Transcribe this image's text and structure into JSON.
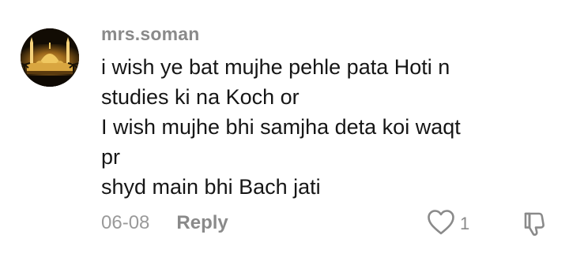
{
  "comment": {
    "username": "mrs.soman",
    "avatar_icon": "mosque-night-avatar",
    "body_lines": [
      "i wish ye bat mujhe pehle pata Hoti n",
      "studies ki na Koch or",
      "I wish mujhe bhi samjha deta koi waqt",
      "pr",
      "shyd main bhi Bach jati"
    ],
    "date": "06-08",
    "reply_label": "Reply",
    "like_count": "1",
    "like_icon": "heart-icon",
    "dislike_icon": "thumbs-down-icon"
  },
  "colors": {
    "username": "#8a8a8a",
    "body": "#161616",
    "meta": "#9a9a9a",
    "background": "#ffffff"
  }
}
